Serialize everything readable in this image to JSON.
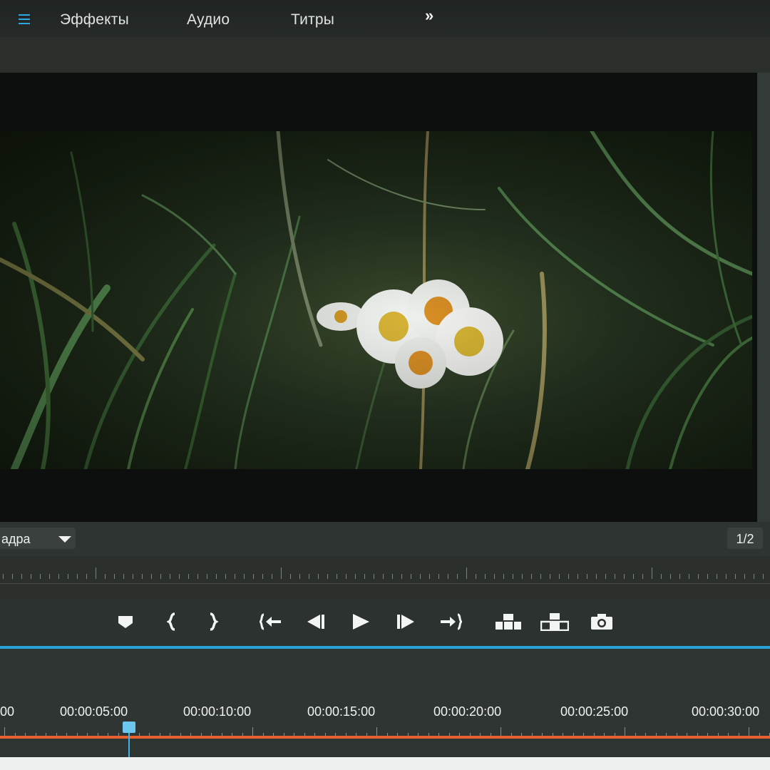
{
  "menu": {
    "tabs": [
      "Эффекты",
      "Аудио",
      "Титры"
    ],
    "menu_icon": "hamburger-icon",
    "more_icon": "double-chevron-right-icon"
  },
  "monitor": {
    "fit_dropdown_label": "адра",
    "page_indicator": "1/2"
  },
  "transport": {
    "controls": [
      {
        "name": "add-marker-button",
        "icon": "marker-icon"
      },
      {
        "name": "mark-in-button",
        "icon": "mark-in-icon"
      },
      {
        "name": "mark-out-button",
        "icon": "mark-out-icon"
      },
      {
        "name": "go-to-in-button",
        "icon": "go-to-in-icon"
      },
      {
        "name": "step-back-button",
        "icon": "step-back-icon"
      },
      {
        "name": "play-button",
        "icon": "play-icon"
      },
      {
        "name": "step-forward-button",
        "icon": "step-forward-icon"
      },
      {
        "name": "go-to-out-button",
        "icon": "go-to-out-icon"
      },
      {
        "name": "insert-button",
        "icon": "insert-icon"
      },
      {
        "name": "overwrite-button",
        "icon": "overwrite-icon"
      },
      {
        "name": "export-frame-button",
        "icon": "camera-icon"
      }
    ]
  },
  "timeline": {
    "timecodes": [
      "00",
      "00:00:05:00",
      "00:00:10:00",
      "00:00:15:00",
      "00:00:20:00",
      "00:00:25:00",
      "00:00:30:00"
    ]
  },
  "colors": {
    "accent": "#2aa3d9",
    "work_area": "#e8612e"
  }
}
